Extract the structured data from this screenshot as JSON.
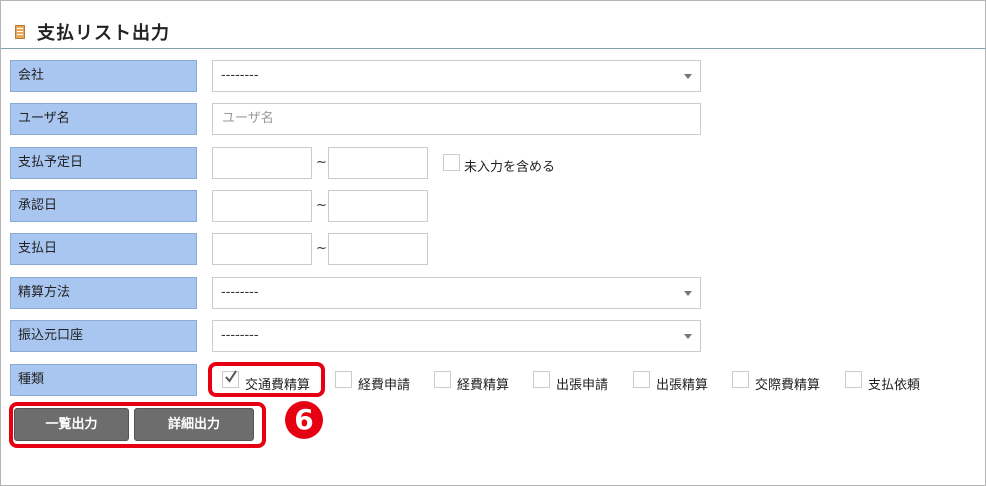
{
  "page": {
    "title": "支払リスト出力"
  },
  "form": {
    "company": {
      "label": "会社",
      "value": "--------"
    },
    "user_name": {
      "label": "ユーザ名",
      "placeholder": "ユーザ名",
      "value": ""
    },
    "payment_due_date": {
      "label": "支払予定日",
      "separator": "~",
      "include_unentered_label": "未入力を含める",
      "include_unentered_checked": false
    },
    "approval_date": {
      "label": "承認日",
      "separator": "~"
    },
    "payment_date": {
      "label": "支払日",
      "separator": "~"
    },
    "settlement_method": {
      "label": "精算方法",
      "value": "--------"
    },
    "transfer_account": {
      "label": "振込元口座",
      "value": "--------"
    },
    "type": {
      "label": "種類",
      "options": [
        {
          "label": "交通費精算",
          "checked": true
        },
        {
          "label": "経費申請",
          "checked": false
        },
        {
          "label": "経費精算",
          "checked": false
        },
        {
          "label": "出張申請",
          "checked": false
        },
        {
          "label": "出張精算",
          "checked": false
        },
        {
          "label": "交際費精算",
          "checked": false
        },
        {
          "label": "支払依頼",
          "checked": false
        }
      ]
    }
  },
  "buttons": {
    "list_output": "一覧出力",
    "detail_output": "詳細出力"
  },
  "annotation": {
    "badge": "6"
  },
  "colors": {
    "label_bg": "#a9c6f0",
    "highlight": "#e60012",
    "button_bg": "#6d6d6d"
  }
}
